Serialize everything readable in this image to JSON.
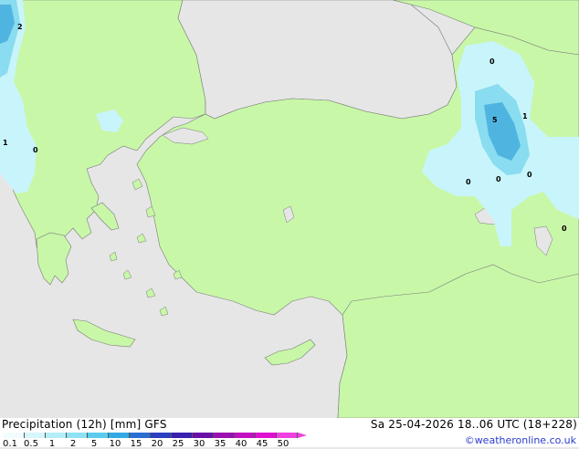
{
  "map": {
    "contour_labels": [
      {
        "text": "2"
      },
      {
        "text": "1"
      },
      {
        "text": "0"
      },
      {
        "text": "0"
      },
      {
        "text": "5"
      },
      {
        "text": "1"
      },
      {
        "text": "0"
      },
      {
        "text": "0"
      },
      {
        "text": "0"
      },
      {
        "text": "0"
      }
    ],
    "colors": {
      "sea": "#e6e6e6",
      "land_no_precip": "#c8f7a8",
      "precip_light": "#c8f5fb",
      "precip_mid": "#8adcf0",
      "precip_heavy": "#4fb5e0",
      "coast": "#808080"
    }
  },
  "footer": {
    "title": "Precipitation (12h) [mm] GFS",
    "datetime": "Sa 25-04-2026 18..06 UTC (18+228)",
    "credit": "©weatheronline.co.uk",
    "scale": {
      "labels": [
        "0.1",
        "0.5",
        "1",
        "2",
        "5",
        "10",
        "15",
        "20",
        "25",
        "30",
        "35",
        "40",
        "45",
        "50"
      ],
      "colors": [
        "#f0fcfe",
        "#d6f6fb",
        "#b4eef8",
        "#8ee2f4",
        "#5ccbee",
        "#32a9e2",
        "#2a6ed2",
        "#2c3fc0",
        "#3a1fb0",
        "#6a10a8",
        "#9a10b0",
        "#c010c0",
        "#e010d0",
        "#f040e0"
      ]
    }
  }
}
